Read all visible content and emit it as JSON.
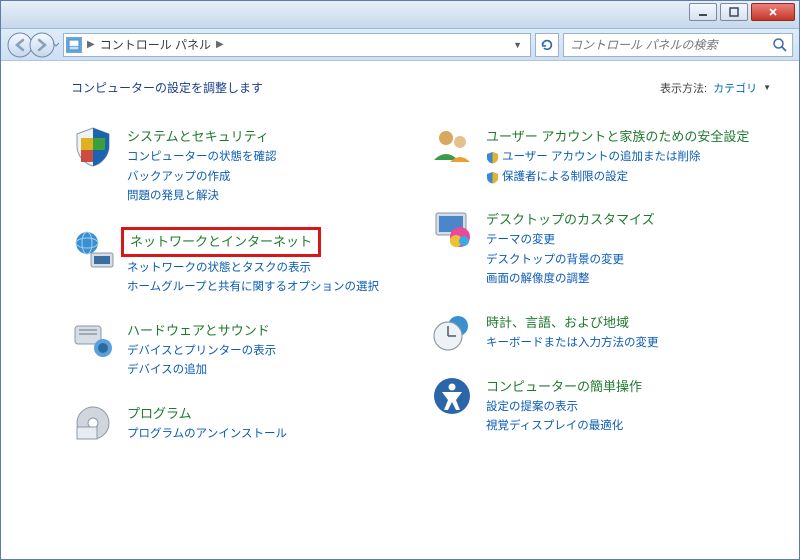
{
  "window": {
    "breadcrumb_label": "コントロール パネル",
    "search_placeholder": "コントロール パネルの検索"
  },
  "header": {
    "adjust_label": "コンピューターの設定を調整します",
    "viewby_label": "表示方法:",
    "viewby_value": "カテゴリ"
  },
  "left": [
    {
      "title": "システムとセキュリティ",
      "subs": [
        {
          "label": "コンピューターの状態を確認",
          "shield": false
        },
        {
          "label": "バックアップの作成",
          "shield": false
        },
        {
          "label": "問題の発見と解決",
          "shield": false
        }
      ]
    },
    {
      "title": "ネットワークとインターネット",
      "highlight": true,
      "subs": [
        {
          "label": "ネットワークの状態とタスクの表示",
          "shield": false
        },
        {
          "label": "ホームグループと共有に関するオプションの選択",
          "shield": false
        }
      ]
    },
    {
      "title": "ハードウェアとサウンド",
      "subs": [
        {
          "label": "デバイスとプリンターの表示",
          "shield": false
        },
        {
          "label": "デバイスの追加",
          "shield": false
        }
      ]
    },
    {
      "title": "プログラム",
      "subs": [
        {
          "label": "プログラムのアンインストール",
          "shield": false
        }
      ]
    }
  ],
  "right": [
    {
      "title": "ユーザー アカウントと家族のための安全設定",
      "subs": [
        {
          "label": "ユーザー アカウントの追加または削除",
          "shield": true
        },
        {
          "label": "保護者による制限の設定",
          "shield": true
        }
      ]
    },
    {
      "title": "デスクトップのカスタマイズ",
      "subs": [
        {
          "label": "テーマの変更",
          "shield": false
        },
        {
          "label": "デスクトップの背景の変更",
          "shield": false
        },
        {
          "label": "画面の解像度の調整",
          "shield": false
        }
      ]
    },
    {
      "title": "時計、言語、および地域",
      "subs": [
        {
          "label": "キーボードまたは入力方法の変更",
          "shield": false
        }
      ]
    },
    {
      "title": "コンピューターの簡単操作",
      "subs": [
        {
          "label": "設定の提案の表示",
          "shield": false
        },
        {
          "label": "視覚ディスプレイの最適化",
          "shield": false
        }
      ]
    }
  ]
}
